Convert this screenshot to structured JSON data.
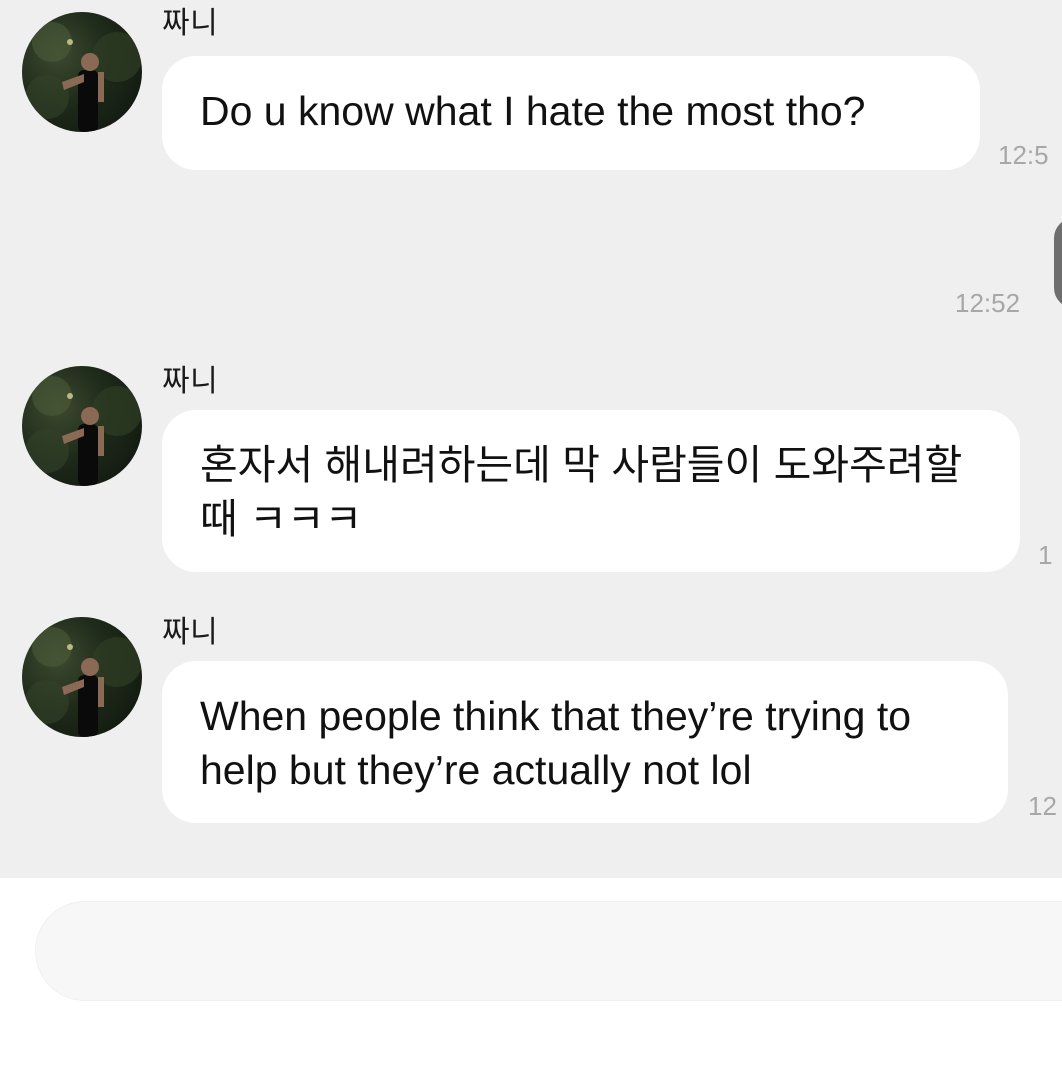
{
  "colors": {
    "chat_background": "#efefef",
    "bubble_background": "#ffffff",
    "outgoing_bubble": "#6e6e6e",
    "timestamp_text": "#a7a7a7",
    "input_background": "#f7f7f7"
  },
  "messages": [
    {
      "sender": "짜니",
      "avatar_icon": "profile-photo-avatar",
      "text": "Do u know what I hate the most tho?",
      "time": "12:5"
    },
    {
      "outgoing": true,
      "time": "12:52"
    },
    {
      "sender": "짜니",
      "avatar_icon": "profile-photo-avatar",
      "text": "혼자서 해내려하는데 막 사람들이 도와주려할 때 ㅋㅋㅋ",
      "time": "1"
    },
    {
      "sender": "짜니",
      "avatar_icon": "profile-photo-avatar",
      "text": "When people think that they’re trying to help but they’re actually not lol",
      "time": "12"
    }
  ],
  "input": {
    "value": "",
    "placeholder": ""
  }
}
